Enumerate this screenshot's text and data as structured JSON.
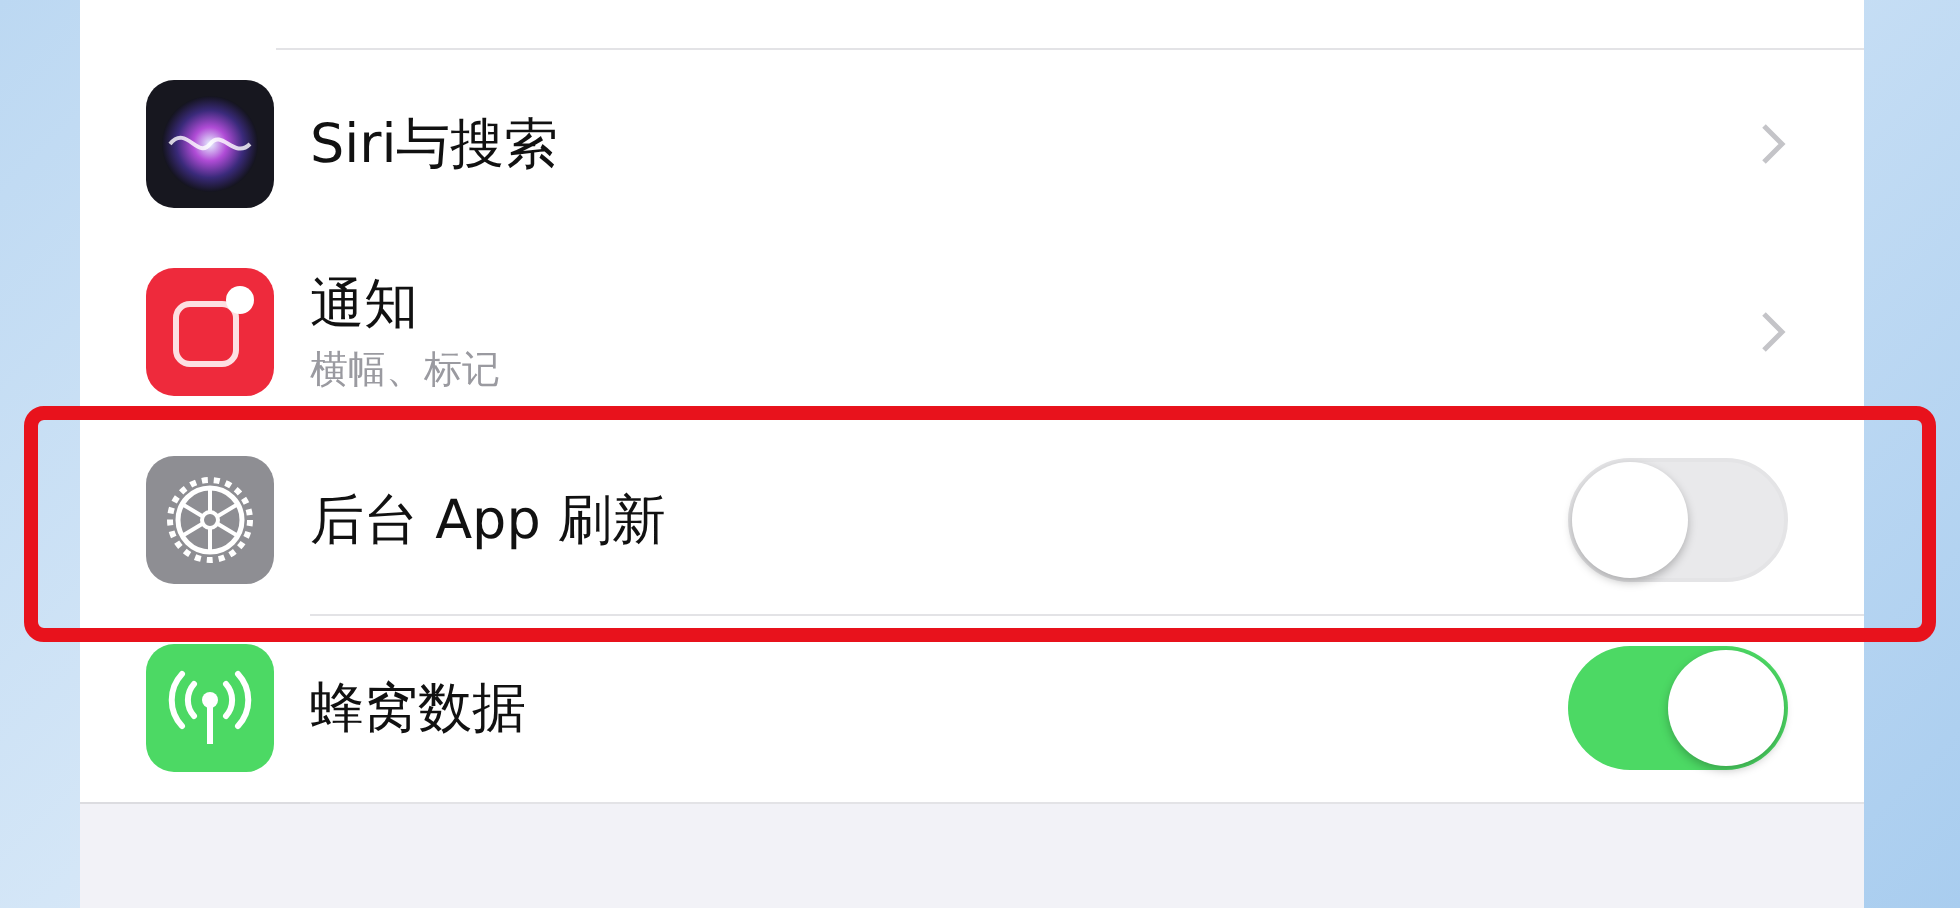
{
  "settings": [
    {
      "kind": "link",
      "title": "Siri与搜索",
      "highlighted": false
    },
    {
      "kind": "link",
      "title": "通知",
      "subtitle": "横幅、标记",
      "highlighted": false
    },
    {
      "kind": "toggle",
      "title": "后台 App 刷新",
      "on": false,
      "highlighted": true
    },
    {
      "kind": "toggle",
      "title": "蜂窝数据",
      "on": true,
      "highlighted": false
    }
  ]
}
